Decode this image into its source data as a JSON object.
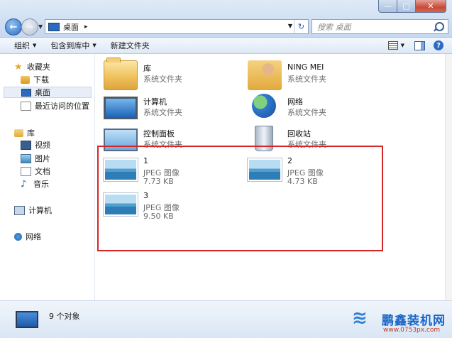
{
  "window": {
    "buttons": {
      "minimize": "—",
      "maximize": "□",
      "close": "✕"
    }
  },
  "address": {
    "path": "桌面",
    "separator": "▸",
    "search_placeholder": "搜索 桌面"
  },
  "toolbar": {
    "organize": "组织",
    "include_in_library": "包含到库中",
    "new_folder": "新建文件夹",
    "dropdown_arrow": "▼",
    "help": "?"
  },
  "sidebar": {
    "favorites": "收藏夹",
    "downloads": "下载",
    "desktop": "桌面",
    "recent": "最近访问的位置",
    "libraries": "库",
    "videos": "视频",
    "pictures": "图片",
    "documents": "文档",
    "music": "音乐",
    "computer": "计算机",
    "network": "网络"
  },
  "items": [
    {
      "name": "库",
      "type": "系统文件夹",
      "icon": "library-folder-icon"
    },
    {
      "name": "NING MEI",
      "type": "系统文件夹",
      "icon": "user-folder-icon"
    },
    {
      "name": "计算机",
      "type": "系统文件夹",
      "icon": "computer-icon"
    },
    {
      "name": "网络",
      "type": "系统文件夹",
      "icon": "network-icon"
    },
    {
      "name": "控制面板",
      "type": "系统文件夹",
      "icon": "control-panel-icon"
    },
    {
      "name": "回收站",
      "type": "系统文件夹",
      "icon": "recycle-bin-icon"
    },
    {
      "name": "1",
      "type": "JPEG 图像",
      "size": "7.73 KB",
      "icon": "jpeg-image-icon"
    },
    {
      "name": "2",
      "type": "JPEG 图像",
      "size": "4.73 KB",
      "icon": "jpeg-image-icon"
    },
    {
      "name": "3",
      "type": "JPEG 图像",
      "size": "9.50 KB",
      "icon": "jpeg-image-icon"
    }
  ],
  "status": {
    "count_text": "9 个对象"
  },
  "watermark": {
    "brand": "鹏鑫装机网",
    "url": "www.0753px.com"
  },
  "colors": {
    "highlight": "#d62728",
    "accent": "#2a6bbf"
  }
}
